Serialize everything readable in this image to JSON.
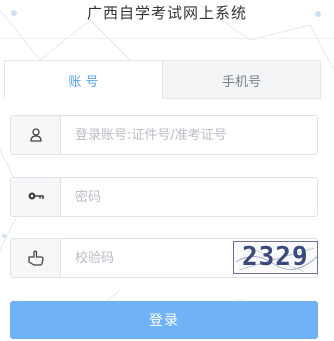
{
  "page": {
    "title": "广西自学考试网上系统"
  },
  "tabs": [
    {
      "label": "账 号",
      "active": true
    },
    {
      "label": "手机号",
      "active": false
    }
  ],
  "form": {
    "account": {
      "placeholder": "登录账号:证件号/准考证号",
      "value": "",
      "icon": "user-icon"
    },
    "password": {
      "placeholder": "密码",
      "value": "",
      "icon": "key-icon"
    },
    "captcha": {
      "placeholder": "校验码",
      "value": "",
      "icon": "hand-pointer-icon",
      "image_text": "2329"
    },
    "submit_label": "登录"
  },
  "colors": {
    "accent": "#5aa3f0",
    "button": "#6fb2f7",
    "captcha_text": "#3a4a7e"
  }
}
